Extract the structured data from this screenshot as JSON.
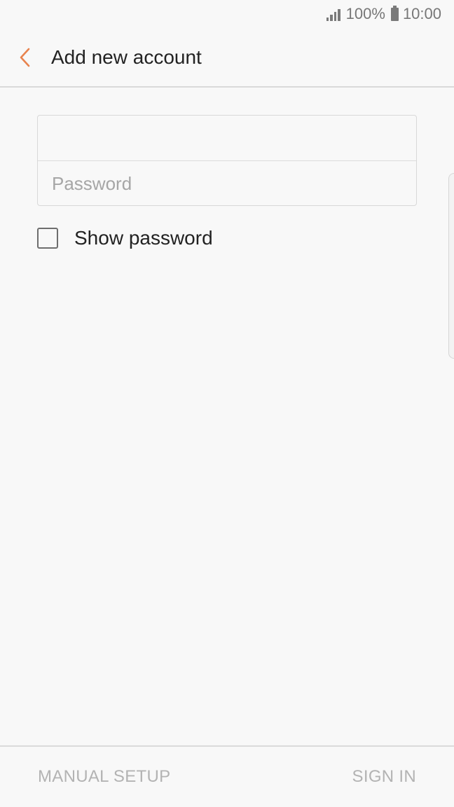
{
  "status_bar": {
    "battery_text": "100%",
    "time": "10:00",
    "icons": [
      "signal-icon",
      "battery-icon"
    ]
  },
  "app_bar": {
    "back_icon": "chevron-left-icon",
    "title": "Add new account",
    "accent_color": "#e8834e"
  },
  "form": {
    "email": {
      "value": "",
      "placeholder": ""
    },
    "password": {
      "value": "",
      "placeholder": "Password"
    },
    "show_password": {
      "label": "Show password",
      "checked": false
    }
  },
  "bottom_bar": {
    "left_button": "MANUAL SETUP",
    "right_button": "SIGN IN"
  }
}
